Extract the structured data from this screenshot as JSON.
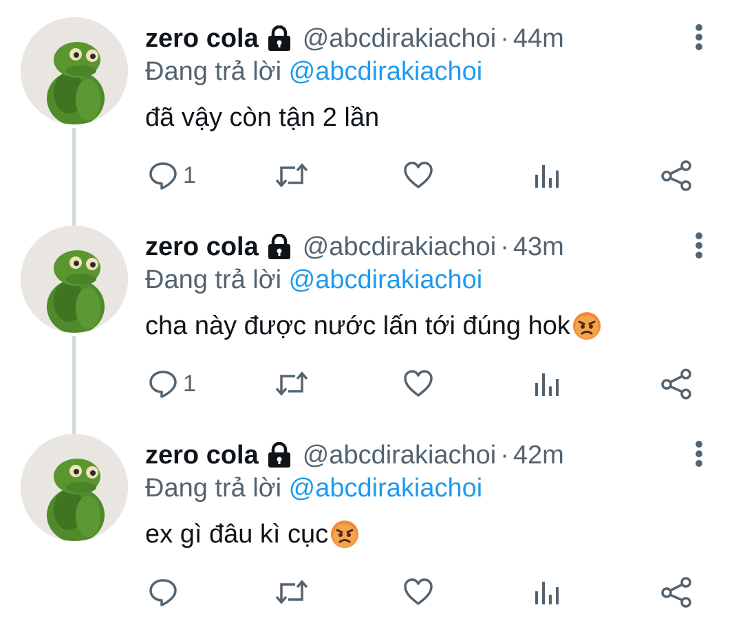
{
  "tweets": [
    {
      "name": "zero cola",
      "handle": "@abcdirakiachoi",
      "time": "44m",
      "reply_prefix": "Đang trả lời",
      "reply_to": "@abcdirakiachoi",
      "text": "đã vậy còn tận 2 lần",
      "emoji": "",
      "reply_count": "1"
    },
    {
      "name": "zero cola",
      "handle": "@abcdirakiachoi",
      "time": "43m",
      "reply_prefix": "Đang trả lời",
      "reply_to": "@abcdirakiachoi",
      "text": "cha này được nước lấn tới đúng hok",
      "emoji": "pouting-face",
      "reply_count": "1"
    },
    {
      "name": "zero cola",
      "handle": "@abcdirakiachoi",
      "time": "42m",
      "reply_prefix": "Đang trả lời",
      "reply_to": "@abcdirakiachoi",
      "text": "ex gì đâu kì cục",
      "emoji": "pouting-face",
      "reply_count": ""
    }
  ],
  "separator": "·",
  "icons": {
    "lock": "lock-icon",
    "more": "more-vertical-icon",
    "reply": "reply-icon",
    "retweet": "retweet-icon",
    "like": "heart-icon",
    "analytics": "analytics-icon",
    "share": "share-icon"
  },
  "colors": {
    "text": "#0f1419",
    "secondary": "#536471",
    "mention": "#1d9bf0",
    "thread_line": "#cfd9de"
  }
}
